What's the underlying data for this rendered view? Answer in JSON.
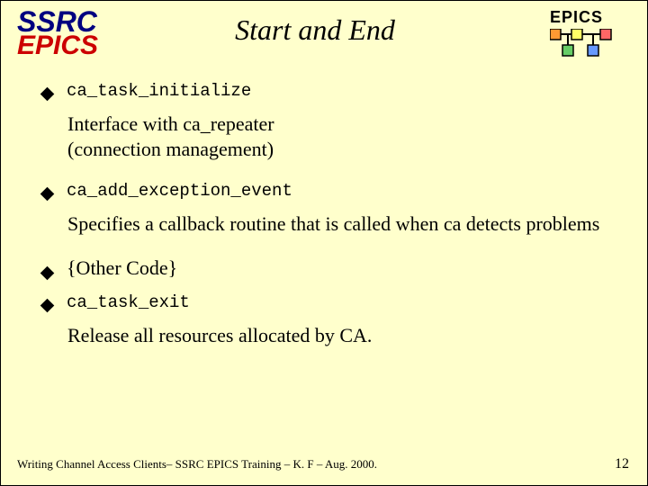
{
  "header": {
    "ssrc": "SSRC",
    "ssrc_epics": "EPICS",
    "title": "Start and End",
    "epics_label": "EPICS"
  },
  "bullets": {
    "b1_code": "ca_task_initialize",
    "b1_desc_l1": "Interface with ca_repeater",
    "b1_desc_l2": " (connection management)",
    "b2_code": "ca_add_exception_event",
    "b2_desc": "Specifies a callback routine that is called when ca detects problems",
    "b3_text": "{Other Code}",
    "b4_code": "ca_task_exit",
    "b4_desc": "Release all resources allocated by CA."
  },
  "footer": {
    "text": "Writing Channel Access Clients– SSRC EPICS Training – K. F – Aug. 2000.",
    "page": "12"
  }
}
